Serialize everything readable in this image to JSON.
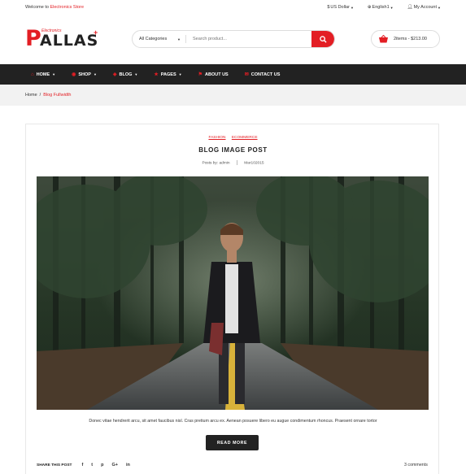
{
  "topbar": {
    "welcome_prefix": "Welcome to",
    "welcome_store": "Electronics Store",
    "currency": "US Dollar",
    "language": "English1",
    "account": "My Account"
  },
  "logo": {
    "main_letter": "P",
    "rest": "ALLAS",
    "sub": "Electronics",
    "plus": "+"
  },
  "search": {
    "category": "All Categories",
    "placeholder": "Search product..."
  },
  "cart": {
    "summary": "2items - $213.00"
  },
  "nav": {
    "items": [
      {
        "label": "HOME",
        "icon": "house-icon",
        "dropdown": true
      },
      {
        "label": "SHOP",
        "icon": "basket-icon",
        "dropdown": true
      },
      {
        "label": "BLOG",
        "icon": "chat-icon",
        "dropdown": true
      },
      {
        "label": "PAGES",
        "icon": "star-icon",
        "dropdown": true
      },
      {
        "label": "ABOUT US",
        "icon": "flag-icon",
        "dropdown": false
      },
      {
        "label": "CONTACT US",
        "icon": "mail-icon",
        "dropdown": false
      }
    ]
  },
  "breadcrumb": {
    "home": "Home",
    "separator": "/",
    "current": "Blog Fullwidth"
  },
  "post": {
    "categories": [
      "FASHION",
      "ECOMMERCE"
    ],
    "title": "BLOG IMAGE POST",
    "author": "Posts by: admin",
    "date": "Mar102015",
    "excerpt": "Donec vitae hendrerit arcu, sit amet faucibus nisl. Cras pretium arcu ex. Aenean posuere libero eu augue condimentum rhoncus. Praesent ornare tortor",
    "read_more": "READ MORE",
    "share_label": "SHARE THIS POST",
    "share_icons": [
      "f",
      "t",
      "p",
      "G+",
      "in"
    ],
    "comments": "3 comments"
  },
  "colors": {
    "accent": "#e31e24",
    "nav_bg": "#222222",
    "crumb_bg": "#f2f2f2"
  }
}
